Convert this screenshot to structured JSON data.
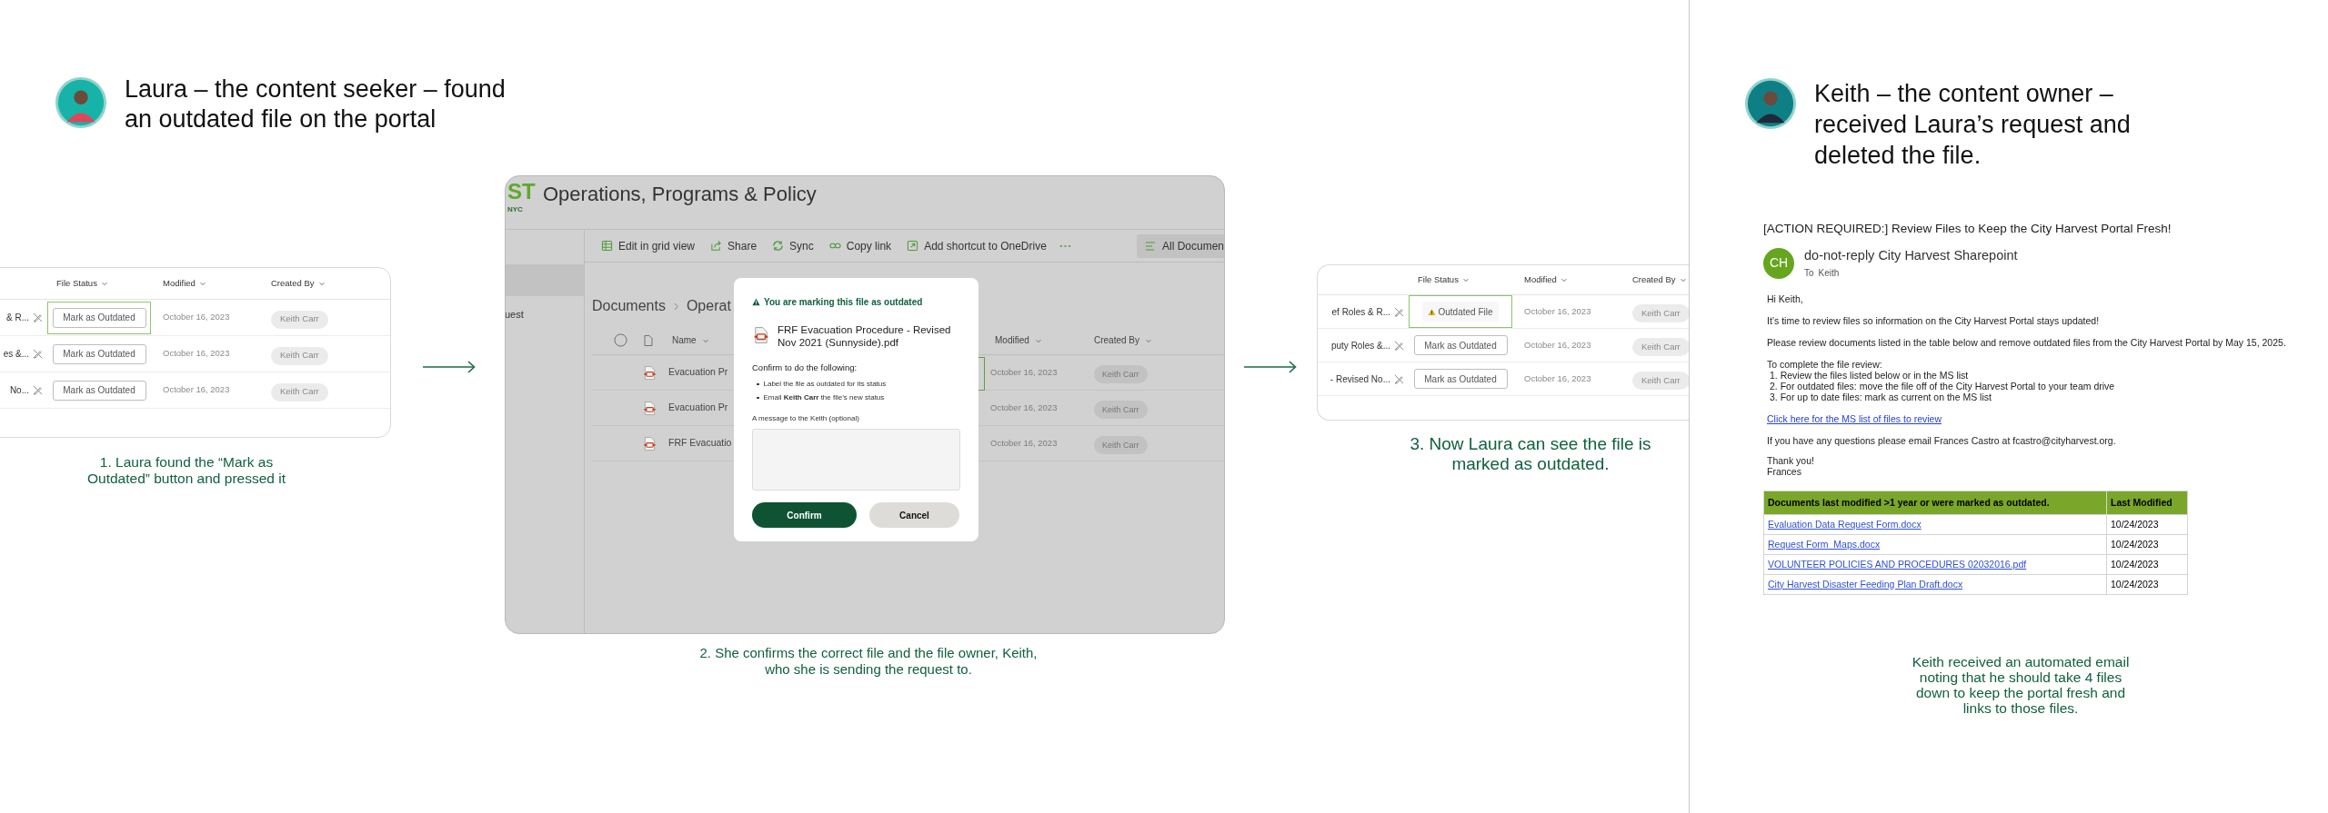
{
  "personas": [
    {
      "heading": "Laura – the content seeker – found\nan outdated file on the portal"
    },
    {
      "heading": "Keith – the content owner –\nreceived Laura’s request and\ndeleted the file."
    }
  ],
  "steps": [
    {
      "kind": "file_list",
      "caption": "1. Laura found the “Mark as\nOutdated” button and pressed it",
      "columns": [
        "File Status",
        "Modified",
        "Created By"
      ],
      "rows": [
        {
          "name": "& R...",
          "marked_outdated": false,
          "status": "Mark as Outdated",
          "highlighted": true,
          "modified": "October 16, 2023",
          "created_by": "Keith Carr"
        },
        {
          "name": "es &...",
          "marked_outdated": false,
          "status": "Mark as Outdated",
          "highlighted": false,
          "modified": "October 16, 2023",
          "created_by": "Keith Carr"
        },
        {
          "name": "No...",
          "marked_outdated": false,
          "status": "Mark as Outdated",
          "highlighted": false,
          "modified": "October 16, 2023",
          "created_by": "Keith Carr"
        }
      ]
    },
    {
      "kind": "portal",
      "caption": "2. She confirms the correct file and the file owner, Keith,\nwho she is sending the request to.",
      "portal": {
        "logo": "ST",
        "logo_sub": "NYC",
        "title": "Operations, Programs & Policy",
        "sidebar_item": "uest",
        "toolbar": [
          "Edit in grid view",
          "Share",
          "Sync",
          "Copy link",
          "Add shortcut to OneDrive"
        ],
        "view_button": "All Documen",
        "breadcrumb": [
          "Documents",
          "Operat"
        ],
        "select_all_checked": false,
        "columns": [
          "Name",
          "Modified",
          "Created By"
        ],
        "rows": [
          {
            "name": "Evacuation Pr",
            "modified": "October 16, 2023",
            "created_by": "Keith Carr"
          },
          {
            "name": "Evacuation Pr",
            "modified": "October 16, 2023",
            "created_by": "Keith Carr"
          },
          {
            "name": "FRF Evacuatio",
            "modified": "October 16, 2023",
            "created_by": "Keith Carr"
          }
        ],
        "dialog": {
          "alert": "You are marking this file as outdated",
          "file_name": "FRF Evacuation Procedure - Revised Nov 2021 (Sunnyside).pdf",
          "intro": "Confirm to do the following:",
          "bullets": [
            "Label the file as outdated for its status",
            "Email **Keith Carr** the file’s new status"
          ],
          "message_label": "A message to the Keith (optional)",
          "buttons": [
            {
              "label": "Confirm",
              "kind": "primary"
            },
            {
              "label": "Cancel",
              "kind": "secondary"
            }
          ]
        }
      }
    },
    {
      "kind": "file_list",
      "caption": "3. Now Laura can see the file is\nmarked as outdated.",
      "columns": [
        "File Status",
        "Modified",
        "Created By"
      ],
      "rows": [
        {
          "name": "ef Roles & R...",
          "marked_outdated": true,
          "status": "Outdated File",
          "highlighted": true,
          "modified": "October 16, 2023",
          "created_by": "Keith Carr"
        },
        {
          "name": "puty Roles &...",
          "marked_outdated": false,
          "status": "Mark as Outdated",
          "highlighted": false,
          "modified": "October 16, 2023",
          "created_by": "Keith Carr"
        },
        {
          "name": "- Revised No...",
          "marked_outdated": false,
          "status": "Mark as Outdated",
          "highlighted": false,
          "modified": "October 16, 2023",
          "created_by": "Keith Carr"
        }
      ]
    },
    {
      "kind": "email",
      "caption": "Keith received an automated email\nnoting that he should take 4 files\ndown to keep the portal fresh and\nlinks to those files.",
      "email": {
        "subject": "[ACTION REQUIRED:] Review Files to Keep the City Harvest Portal Fresh!",
        "sender_initials": "CH",
        "sender": "do-not-reply City Harvest Sharepoint",
        "to_label": "To",
        "to": "Keith",
        "greeting": "Hi Keith,",
        "paragraphs": [
          "It’s time to review files so information on the City Harvest Portal stays updated!",
          "Please review documents listed in the table below and remove outdated files from the City Harvest Portal by May 15, 2025."
        ],
        "steps_intro": "To complete the file review:",
        "steps": [
          "1. Review the files listed below or in the MS list",
          "2. For outdated files: move the file off of the City Harvest Portal to your team drive",
          "3. For up to date files: mark as current on the MS list"
        ],
        "link": "Click here for the MS list of files to review",
        "contact": "If you have any questions please email Frances Castro at fcastro@cityharvest.org.",
        "signoff": "Thank you!",
        "signature": "Frances",
        "table": {
          "columns": [
            "Documents last modified >1 year or were marked as outdated.",
            "Last Modified"
          ],
          "rows": [
            {
              "file": "Evaluation Data Request Form.docx",
              "last_modified": "10/24/2023"
            },
            {
              "file": "Request Form_Maps.docx",
              "last_modified": "10/24/2023"
            },
            {
              "file": "VOLUNTEER POLICIES AND PROCEDURES 02032016.pdf",
              "last_modified": "10/24/2023"
            },
            {
              "file": "City Harvest Disaster Feeding Plan Draft.docx",
              "last_modified": "10/24/2023"
            }
          ]
        }
      }
    }
  ]
}
